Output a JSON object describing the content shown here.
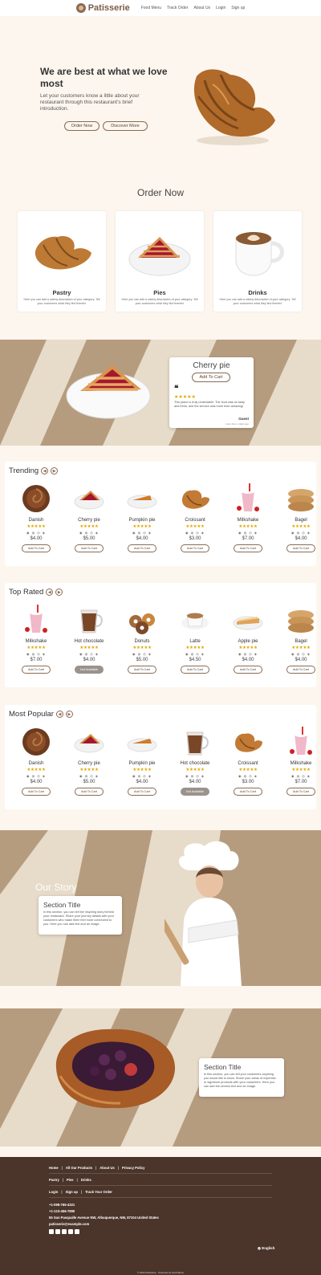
{
  "header": {
    "brand": "Patisserie",
    "nav": [
      "Food Menu",
      "Track Order",
      "About Us",
      "Login",
      "Sign up"
    ]
  },
  "hero": {
    "title": "We are best at what we love most",
    "subtitle": "Let your customers know a little about your restaurant through this restaurant's brief introduction.",
    "order_btn": "Order Now",
    "discover_btn": "Discover More"
  },
  "order": {
    "title": "Order Now",
    "categories": [
      {
        "name": "Pastry",
        "desc": "Here you can add a catchy description of your category. Tell your customers what they find therein!"
      },
      {
        "name": "Pies",
        "desc": "Here you can add a catchy description of your category. Tell your customers what they find therein!"
      },
      {
        "name": "Drinks",
        "desc": "Here you can add a catchy description of your category. Tell your customers what they find therein!"
      }
    ]
  },
  "featured": {
    "title": "Cherry pie",
    "cart_btn": "Add To Cart",
    "quote": "❝",
    "stars": "★★★★★",
    "review": "This place is truly undeniable. The food was so tasty and fresh, and the service was more than amazing!",
    "author": "Guest",
    "ago": "more than 1 days ago"
  },
  "trending": {
    "title": "Trending",
    "items": [
      {
        "name": "Danish",
        "price": "$4.00",
        "btn": "Add To Cart"
      },
      {
        "name": "Cherry pie",
        "price": "$5.00",
        "btn": "Add To Cart"
      },
      {
        "name": "Pumpkin pie",
        "price": "$4.00",
        "btn": "Add To Cart"
      },
      {
        "name": "Croissant",
        "price": "$3.00",
        "btn": "Add To Cart"
      },
      {
        "name": "Milkshake",
        "price": "$7.00",
        "btn": "Add To Cart"
      },
      {
        "name": "Bagel",
        "price": "$4.00",
        "btn": "Add To Cart"
      }
    ]
  },
  "top_rated": {
    "title": "Top Rated",
    "items": [
      {
        "name": "Milkshake",
        "price": "$7.00",
        "btn": "Add To Cart"
      },
      {
        "name": "Hot chocolate",
        "price": "$4.00",
        "btn": "Not Available"
      },
      {
        "name": "Donuts",
        "price": "$5.00",
        "btn": "Add To Cart"
      },
      {
        "name": "Latte",
        "price": "$4.50",
        "btn": "Add To Cart"
      },
      {
        "name": "Apple pie",
        "price": "$4.00",
        "btn": "Add To Cart"
      },
      {
        "name": "Bagel",
        "price": "$4.00",
        "btn": "Add To Cart"
      }
    ]
  },
  "most_popular": {
    "title": "Most Popular",
    "items": [
      {
        "name": "Danish",
        "price": "$4.00",
        "btn": "Add To Cart"
      },
      {
        "name": "Cherry pie",
        "price": "$5.00",
        "btn": "Add To Cart"
      },
      {
        "name": "Pumpkin pie",
        "price": "$4.00",
        "btn": "Add To Cart"
      },
      {
        "name": "Hot chocolate",
        "price": "$4.00",
        "btn": "Not Available"
      },
      {
        "name": "Croissant",
        "price": "$3.00",
        "btn": "Add To Cart"
      },
      {
        "name": "Milkshake",
        "price": "$7.00",
        "btn": "Add To Cart"
      }
    ]
  },
  "stars": "★★★★★",
  "diet_icons": "◉ ◍ ◎ ◈",
  "story": {
    "title": "Our Story",
    "card_title": "Section Title",
    "card_text": "In this section, you can tell the inspiring story behind your restaurant. Share your journey details with your customers who make them feel more connected to you. Here you can add text and an image."
  },
  "section2": {
    "card_title": "Section Title",
    "card_text": "In this section, you can tell your customers anything you would like to know. Share your areas of expertise or signature products with your customers. Here you can add the section text and an image."
  },
  "footer": {
    "row1": [
      "Home",
      "All Our Products",
      "About Us",
      "Privacy Policy"
    ],
    "row2": [
      "Pastry",
      "Pies",
      "Drinks"
    ],
    "row3": [
      "Login",
      "Sign up",
      "Track Your Order"
    ],
    "phone1": "+1-098-765-4321",
    "phone2": "+1-123-456-7890",
    "address": "55 San Pasqualle Avenue NW, Albuquerque, NM, 87104 United States",
    "email": "patisserie@example.com",
    "language": "English",
    "copyright": "© 2024 Patisserie · Powered by Food Menu"
  },
  "colors": {
    "accent": "#8b6a52",
    "band_light": "#e7dbc9",
    "band_dark": "#b69c7f",
    "footer": "#4b342a",
    "star": "#e0a800"
  }
}
